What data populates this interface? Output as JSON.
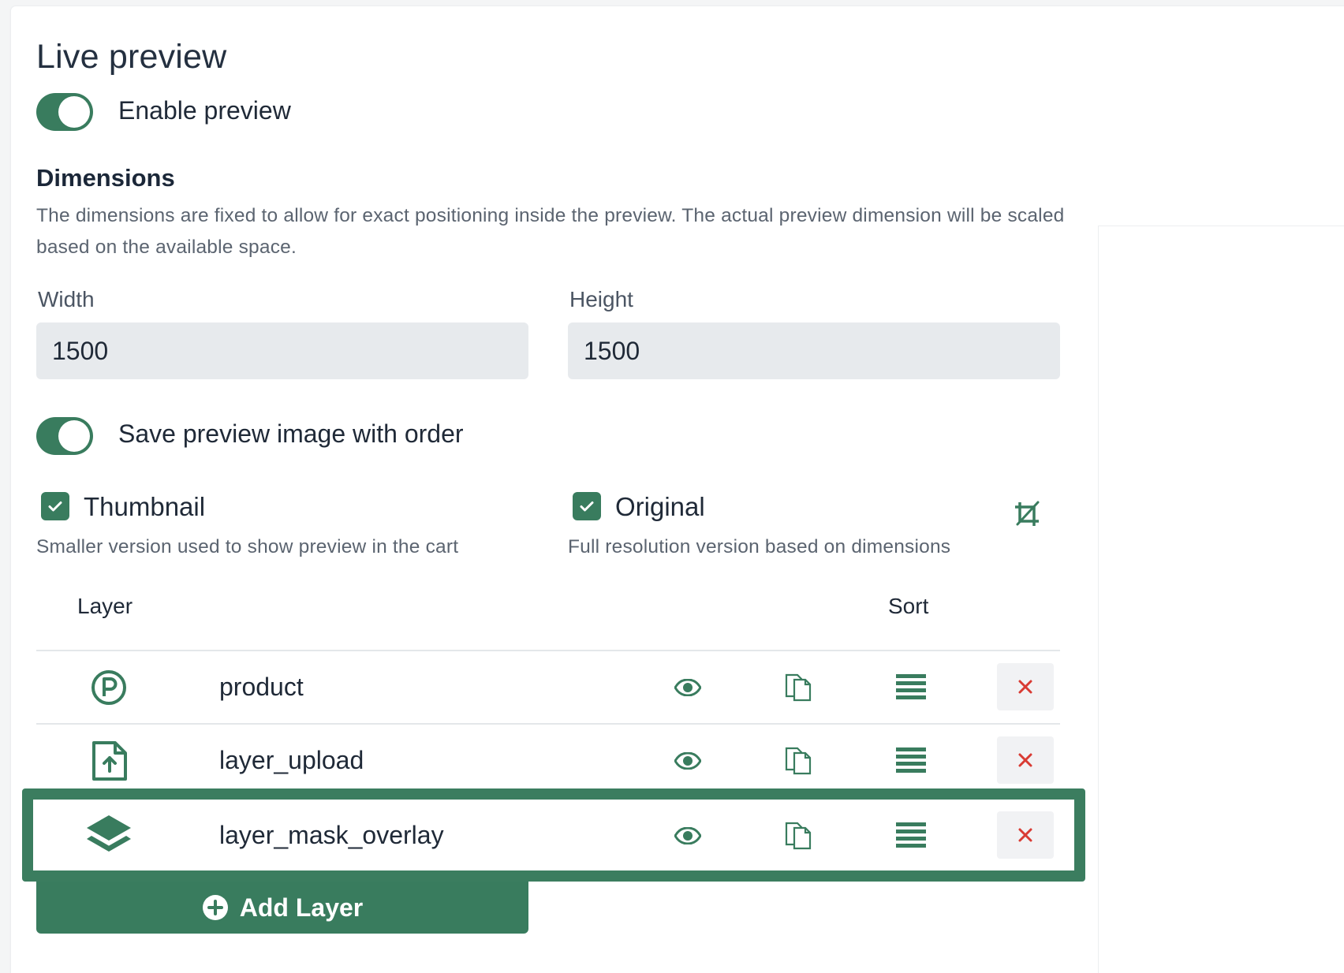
{
  "title": "Live preview",
  "enable_preview": {
    "label": "Enable preview",
    "on": true
  },
  "dimensions": {
    "title": "Dimensions",
    "description": "The dimensions are fixed to allow for exact positioning inside the preview. The actual preview dimension will be scaled based on the available space.",
    "width_label": "Width",
    "width_value": "1500",
    "height_label": "Height",
    "height_value": "1500"
  },
  "save_preview": {
    "label": "Save preview image with order",
    "on": true
  },
  "options": {
    "thumbnail": {
      "label": "Thumbnail",
      "description": "Smaller version used to show preview in the cart",
      "checked": true
    },
    "original": {
      "label": "Original",
      "description": "Full resolution version based on dimensions",
      "checked": true
    },
    "crop_icon": "crop-icon"
  },
  "table": {
    "col_layer": "Layer",
    "col_sort": "Sort",
    "rows": [
      {
        "name": "product",
        "icon": "product-p-icon"
      },
      {
        "name": "layer_upload",
        "icon": "file-upload-icon"
      },
      {
        "name": "layer_mask_overlay",
        "icon": "layers-icon",
        "highlighted": true
      }
    ]
  },
  "add_layer": {
    "label": "Add Layer",
    "icon": "plus-circle-icon"
  },
  "colors": {
    "accent": "#397c5e",
    "delete": "#d93b33",
    "input_bg": "#e7eaed"
  }
}
